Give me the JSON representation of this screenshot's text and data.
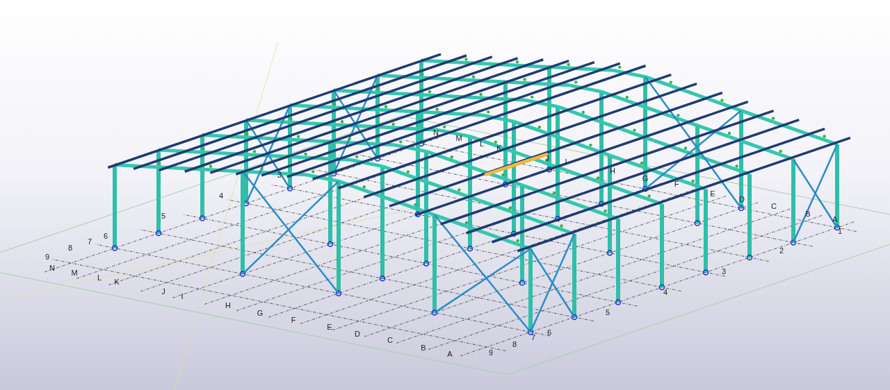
{
  "model_view": {
    "grid_labels": [
      "9",
      "N",
      "M",
      "L",
      "K",
      "J",
      "I",
      "H",
      "G",
      "F",
      "E",
      "D",
      "C",
      "B",
      "A",
      "9",
      "8",
      "7",
      "6",
      "5",
      "4",
      "3",
      "2",
      "1",
      "A",
      "B",
      "C",
      "8",
      "7",
      "6",
      "5",
      "4",
      "3",
      "N",
      "M",
      "L",
      "K",
      "J",
      "I",
      "H",
      "G",
      "F",
      "E",
      "D"
    ]
  }
}
